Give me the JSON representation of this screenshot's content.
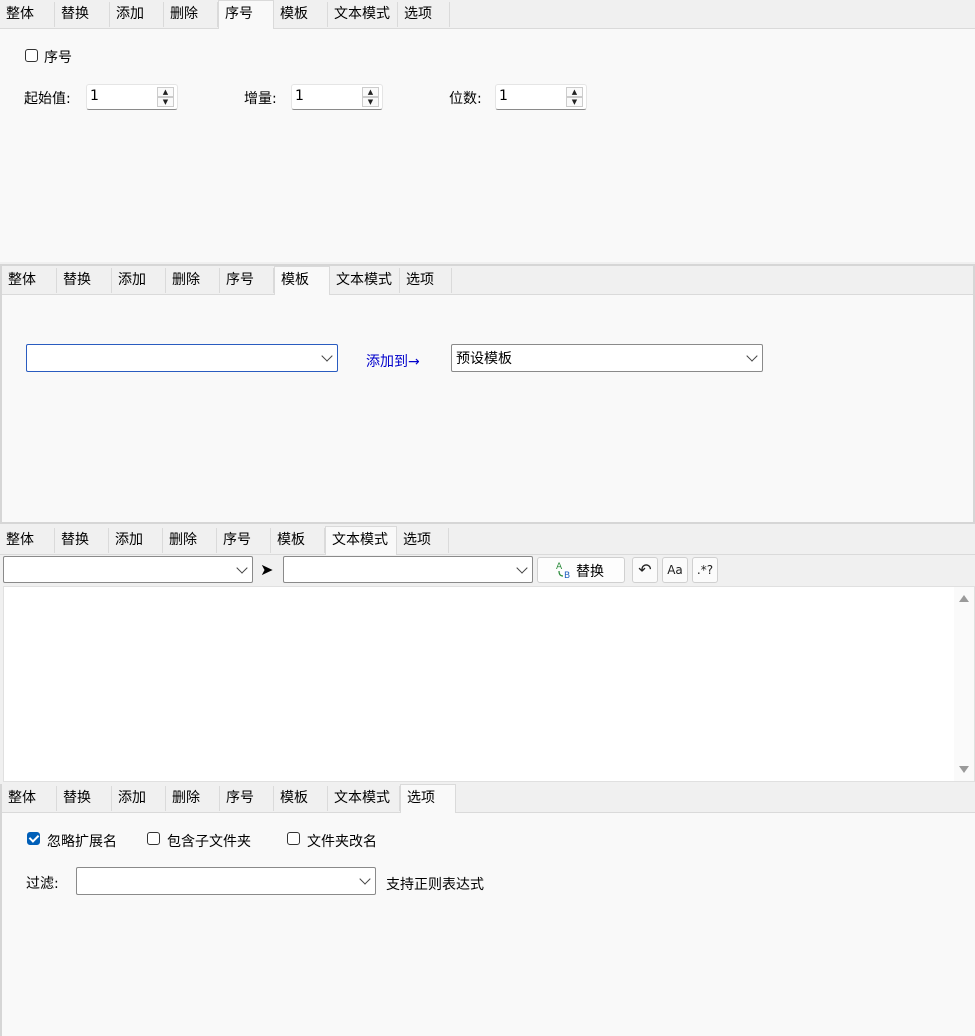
{
  "tabs": [
    "整体",
    "替换",
    "添加",
    "删除",
    "序号",
    "模板",
    "文本模式",
    "选项"
  ],
  "serial_panel": {
    "enable_label": "序号",
    "start_label": "起始值:",
    "start_value": "1",
    "step_label": "增量:",
    "step_value": "1",
    "digits_label": "位数:",
    "digits_value": "1"
  },
  "template_panel": {
    "template_value": "",
    "add_to_label": "添加到→",
    "preset_value": "预设模板"
  },
  "text_mode_panel": {
    "find_value": "",
    "arrow_glyph": "➤",
    "replace_value": "",
    "replace_button_label": "替换",
    "undo_icon": "↶",
    "case_icon_label": "Aa",
    "regex_icon_label": ".*?"
  },
  "options_panel": {
    "ignore_ext_label": "忽略扩展名",
    "ignore_ext_checked": true,
    "include_subfolders_label": "包含子文件夹",
    "include_subfolders_checked": false,
    "rename_folders_label": "文件夹改名",
    "rename_folders_checked": false,
    "filter_label": "过滤:",
    "filter_value": "",
    "regex_hint": "支持正则表达式"
  },
  "colors": {
    "accent": "#005fb8",
    "link": "#0000cc"
  }
}
